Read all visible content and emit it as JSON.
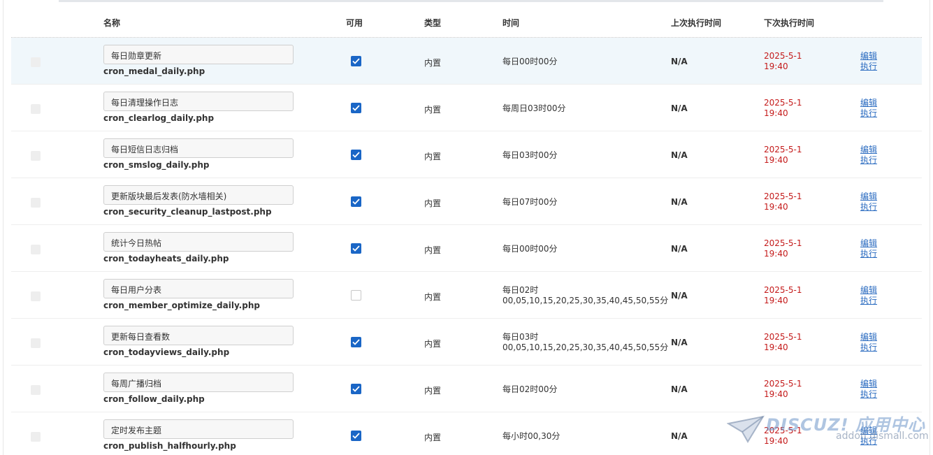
{
  "header": {
    "name": "名称",
    "available": "可用",
    "type": "类型",
    "time": "时间",
    "last_run": "上次执行时间",
    "next_run": "下次执行时间"
  },
  "colors": {
    "accent": "#1a66c6",
    "next_run": "#c41a1a",
    "link": "#2a6bc0",
    "row_highlight": "#f0f7fb"
  },
  "rows": [
    {
      "name": "每日勋章更新",
      "file": "cron_medal_daily.php",
      "available": true,
      "type": "内置",
      "time": [
        "每日00时00分"
      ],
      "last": "N/A",
      "next": [
        "2025-5-1",
        "19:40"
      ],
      "edit": "编辑",
      "run": "执行"
    },
    {
      "name": "每日清理操作日志",
      "file": "cron_clearlog_daily.php",
      "available": true,
      "type": "内置",
      "time": [
        "每周日03时00分"
      ],
      "last": "N/A",
      "next": [
        "2025-5-1",
        "19:40"
      ],
      "edit": "编辑",
      "run": "执行"
    },
    {
      "name": "每日短信日志归档",
      "file": "cron_smslog_daily.php",
      "available": true,
      "type": "内置",
      "time": [
        "每日03时00分"
      ],
      "last": "N/A",
      "next": [
        "2025-5-1",
        "19:40"
      ],
      "edit": "编辑",
      "run": "执行"
    },
    {
      "name": "更新版块最后发表(防水墙相关)",
      "file": "cron_security_cleanup_lastpost.php",
      "available": true,
      "type": "内置",
      "time": [
        "每日07时00分"
      ],
      "last": "N/A",
      "next": [
        "2025-5-1",
        "19:40"
      ],
      "edit": "编辑",
      "run": "执行"
    },
    {
      "name": "统计今日热帖",
      "file": "cron_todayheats_daily.php",
      "available": true,
      "type": "内置",
      "time": [
        "每日00时00分"
      ],
      "last": "N/A",
      "next": [
        "2025-5-1",
        "19:40"
      ],
      "edit": "编辑",
      "run": "执行"
    },
    {
      "name": "每日用户分表",
      "file": "cron_member_optimize_daily.php",
      "available": false,
      "type": "内置",
      "time": [
        "每日02时",
        "00,05,10,15,20,25,30,35,40,45,50,55分"
      ],
      "last": "N/A",
      "next": [
        "2025-5-1",
        "19:40"
      ],
      "edit": "编辑",
      "run": "执行"
    },
    {
      "name": "更新每日查看数",
      "file": "cron_todayviews_daily.php",
      "available": true,
      "type": "内置",
      "time": [
        "每日03时",
        "00,05,10,15,20,25,30,35,40,45,50,55分"
      ],
      "last": "N/A",
      "next": [
        "2025-5-1",
        "19:40"
      ],
      "edit": "编辑",
      "run": "执行"
    },
    {
      "name": "每周广播归档",
      "file": "cron_follow_daily.php",
      "available": true,
      "type": "内置",
      "time": [
        "每日02时00分"
      ],
      "last": "N/A",
      "next": [
        "2025-5-1",
        "19:40"
      ],
      "edit": "编辑",
      "run": "执行"
    },
    {
      "name": "定时发布主题",
      "file": "cron_publish_halfhourly.php",
      "available": true,
      "type": "内置",
      "time": [
        "每小时00,30分"
      ],
      "last": "N/A",
      "next": [
        "2025-5-1",
        "19:40"
      ],
      "edit": "编辑",
      "run": "执行"
    }
  ],
  "watermark": {
    "brand": "DISCUZ! 应用中心",
    "url": "addon.dismall.com"
  }
}
